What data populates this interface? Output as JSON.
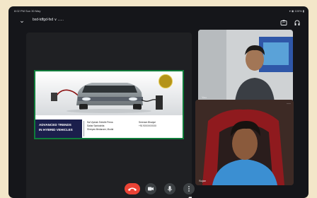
{
  "status_bar": {
    "time": "8:02 PM  Sun 30 May",
    "system": "▾ ◉ 100% ▮"
  },
  "meeting": {
    "title": "bxd-tdfgd-fxd ∨ ......"
  },
  "slide": {
    "title_line1": "ADVANCED TRENDS",
    "title_line2": "IN HYBRID VEHICLES",
    "col1": [
      "Sai Vyshak Srinidhi Pema",
      "Sahar Santoshita",
      "Shreyas Medanam, Mudal"
    ],
    "col2": [
      "Sreeram Bhanjal",
      "+91 9XXXXXXXX"
    ]
  },
  "participants": [
    {
      "name": "You"
    },
    {
      "name": "Sujan"
    }
  ],
  "colors": {
    "background": "#f3e6c9",
    "screen": "#15161a",
    "tile": "#2c2d31",
    "end_call": "#ea4335",
    "slide_border": "#0f7c3a",
    "slide_title_bg": "#1b1f4c"
  },
  "icons": [
    "back-arrow-icon",
    "switch-camera-icon",
    "audio-output-icon",
    "more-icon",
    "screen-share-icon",
    "end-call-icon",
    "camera-icon",
    "mic-icon",
    "overflow-menu-icon"
  ]
}
